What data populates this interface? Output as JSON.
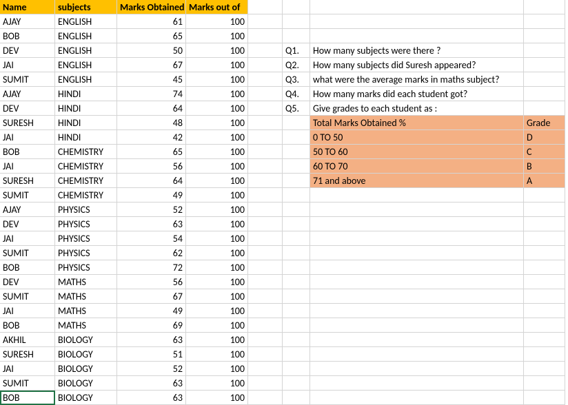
{
  "headers": {
    "c0": "Name",
    "c1": "subjects",
    "c2": "Marks Obtained",
    "c3": "Marks out of"
  },
  "rows": [
    {
      "name": "AJAY",
      "subj": "ENGLISH",
      "marks": "61",
      "outof": "100"
    },
    {
      "name": "BOB",
      "subj": "ENGLISH",
      "marks": "65",
      "outof": "100"
    },
    {
      "name": "DEV",
      "subj": "ENGLISH",
      "marks": "50",
      "outof": "100"
    },
    {
      "name": "JAI",
      "subj": "ENGLISH",
      "marks": "67",
      "outof": "100"
    },
    {
      "name": "SUMIT",
      "subj": "ENGLISH",
      "marks": "45",
      "outof": "100"
    },
    {
      "name": "AJAY",
      "subj": "HINDI",
      "marks": "74",
      "outof": "100"
    },
    {
      "name": "DEV",
      "subj": "HINDI",
      "marks": "64",
      "outof": "100"
    },
    {
      "name": "SURESH",
      "subj": "HINDI",
      "marks": "48",
      "outof": "100"
    },
    {
      "name": "JAI",
      "subj": "HINDI",
      "marks": "42",
      "outof": "100"
    },
    {
      "name": "BOB",
      "subj": "CHEMISTRY",
      "marks": "65",
      "outof": "100"
    },
    {
      "name": "JAI",
      "subj": "CHEMISTRY",
      "marks": "56",
      "outof": "100"
    },
    {
      "name": "SURESH",
      "subj": "CHEMISTRY",
      "marks": "64",
      "outof": "100"
    },
    {
      "name": "SUMIT",
      "subj": "CHEMISTRY",
      "marks": "49",
      "outof": "100"
    },
    {
      "name": "AJAY",
      "subj": "PHYSICS",
      "marks": "52",
      "outof": "100"
    },
    {
      "name": "DEV",
      "subj": "PHYSICS",
      "marks": "63",
      "outof": "100"
    },
    {
      "name": "JAI",
      "subj": "PHYSICS",
      "marks": "54",
      "outof": "100"
    },
    {
      "name": "SUMIT",
      "subj": "PHYSICS",
      "marks": "62",
      "outof": "100"
    },
    {
      "name": "BOB",
      "subj": "PHYSICS",
      "marks": "72",
      "outof": "100"
    },
    {
      "name": "DEV",
      "subj": "MATHS",
      "marks": "56",
      "outof": "100"
    },
    {
      "name": "SUMIT",
      "subj": "MATHS",
      "marks": "67",
      "outof": "100"
    },
    {
      "name": "JAI",
      "subj": "MATHS",
      "marks": "49",
      "outof": "100"
    },
    {
      "name": "BOB",
      "subj": "MATHS",
      "marks": "69",
      "outof": "100"
    },
    {
      "name": "AKHIL",
      "subj": "BIOLOGY",
      "marks": "63",
      "outof": "100"
    },
    {
      "name": "SURESH",
      "subj": "BIOLOGY",
      "marks": "51",
      "outof": "100"
    },
    {
      "name": "JAI",
      "subj": "BIOLOGY",
      "marks": "52",
      "outof": "100"
    },
    {
      "name": "SUMIT",
      "subj": "BIOLOGY",
      "marks": "63",
      "outof": "100"
    },
    {
      "name": "BOB",
      "subj": "BIOLOGY",
      "marks": "63",
      "outof": "100"
    }
  ],
  "questions": [
    {
      "label": "Q1.",
      "text": "How many subjects were there ?"
    },
    {
      "label": "Q2.",
      "text": "How many subjects did Suresh appeared?"
    },
    {
      "label": "Q3.",
      "text": "what were the average marks in maths subject?"
    },
    {
      "label": "Q4.",
      "text": "How many marks did each student got?"
    },
    {
      "label": "Q5.",
      "text": "Give grades to each student as :"
    }
  ],
  "gradeTable": {
    "hdr1": "Total Marks Obtained %",
    "hdr2": "Grade",
    "rows": [
      {
        "range": "0 TO 50",
        "grade": "D"
      },
      {
        "range": "50 TO 60",
        "grade": "C"
      },
      {
        "range": "60 TO 70",
        "grade": "B"
      },
      {
        "range": "71 and above",
        "grade": "A"
      }
    ]
  }
}
